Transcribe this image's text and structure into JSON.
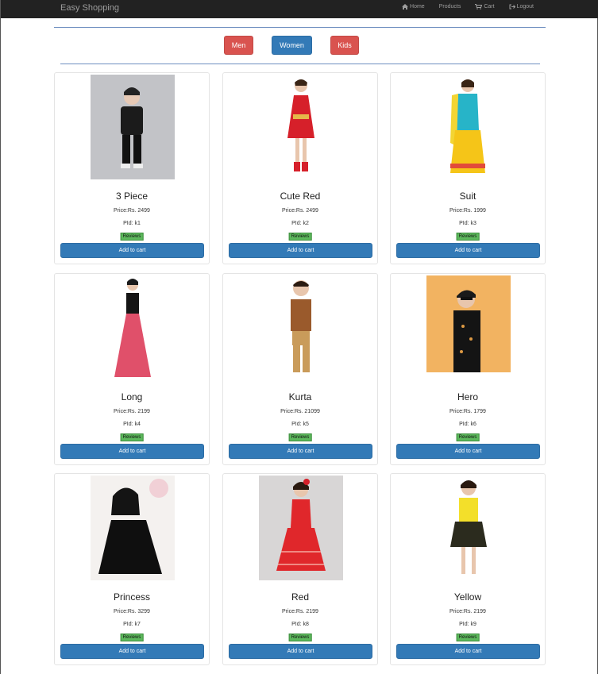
{
  "navbar": {
    "brand": "Easy Shopping",
    "links": [
      {
        "label": "Home",
        "icon": "home-icon"
      },
      {
        "label": "Products",
        "icon": ""
      },
      {
        "label": "Cart",
        "icon": "cart-icon"
      },
      {
        "label": "Logout",
        "icon": "logout-icon"
      }
    ]
  },
  "categories": [
    {
      "label": "Men",
      "color": "#d9534f"
    },
    {
      "label": "Women",
      "color": "#337ab7"
    },
    {
      "label": "Kids",
      "color": "#d9534f"
    }
  ],
  "product_labels": {
    "reviews": "Reviews",
    "add_to_cart": "Add to cart"
  },
  "products": [
    {
      "name": "3 Piece",
      "price": "Price:Rs. 2499",
      "pid": "PId: k1"
    },
    {
      "name": "Cute Red",
      "price": "Price:Rs. 2499",
      "pid": "PId: k2"
    },
    {
      "name": "Suit",
      "price": "Price:Rs. 1999",
      "pid": "PId: k3"
    },
    {
      "name": "Long",
      "price": "Price:Rs. 2199",
      "pid": "PId: k4"
    },
    {
      "name": "Kurta",
      "price": "Price:Rs. 21099",
      "pid": "PId: k5"
    },
    {
      "name": "Hero",
      "price": "Price:Rs. 1799",
      "pid": "PId: k6"
    },
    {
      "name": "Princess",
      "price": "Price:Rs. 3299",
      "pid": "PId: k7"
    },
    {
      "name": "Red",
      "price": "Price:Rs. 2199",
      "pid": "PId: k8"
    },
    {
      "name": "Yellow",
      "price": "Price:Rs. 2199",
      "pid": "PId: k9"
    }
  ]
}
